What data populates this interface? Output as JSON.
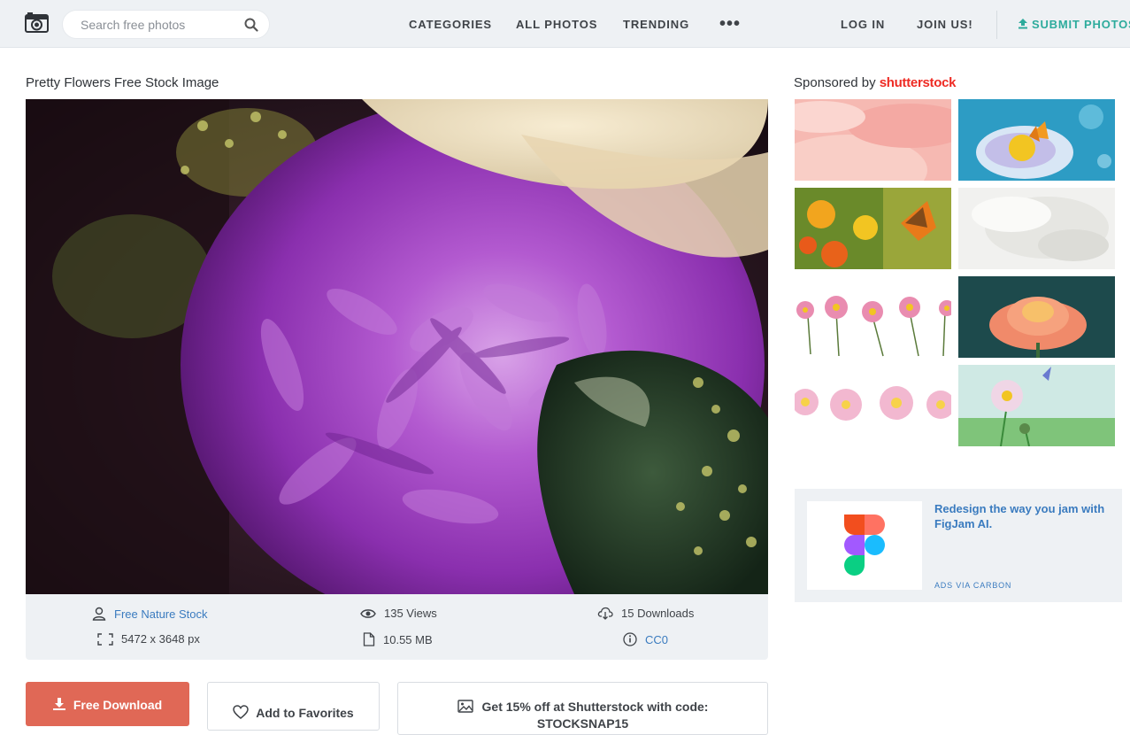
{
  "header": {
    "search_placeholder": "Search free photos",
    "nav": [
      "CATEGORIES",
      "ALL PHOTOS",
      "TRENDING"
    ],
    "more": "•••",
    "login": "LOG IN",
    "join": "JOIN US!",
    "submit": "SUBMIT PHOTOS"
  },
  "photo": {
    "title": "Pretty Flowers Free Stock Image",
    "author": "Free Nature Stock",
    "views": "135 Views",
    "downloads": "15 Downloads",
    "dimensions": "5472 x 3648 px",
    "file_size": "10.55 MB",
    "license": "CC0"
  },
  "actions": {
    "download": "Free Download",
    "favorites": "Add to Favorites",
    "promo_line1": "Get 15% off at Shutterstock with code:",
    "promo_line2": "STOCKSNAP15"
  },
  "sidebar": {
    "sponsored_prefix": "Sponsored by",
    "sponsored_brand": "shutterstock"
  },
  "ad": {
    "text": "Redesign the way you jam with FigJam AI.",
    "via": "ADS VIA CARBON"
  },
  "colors": {
    "accent": "#2dab9c",
    "download_button": "#e06856",
    "link": "#3a7bbf",
    "header_bg": "#eef1f4"
  }
}
